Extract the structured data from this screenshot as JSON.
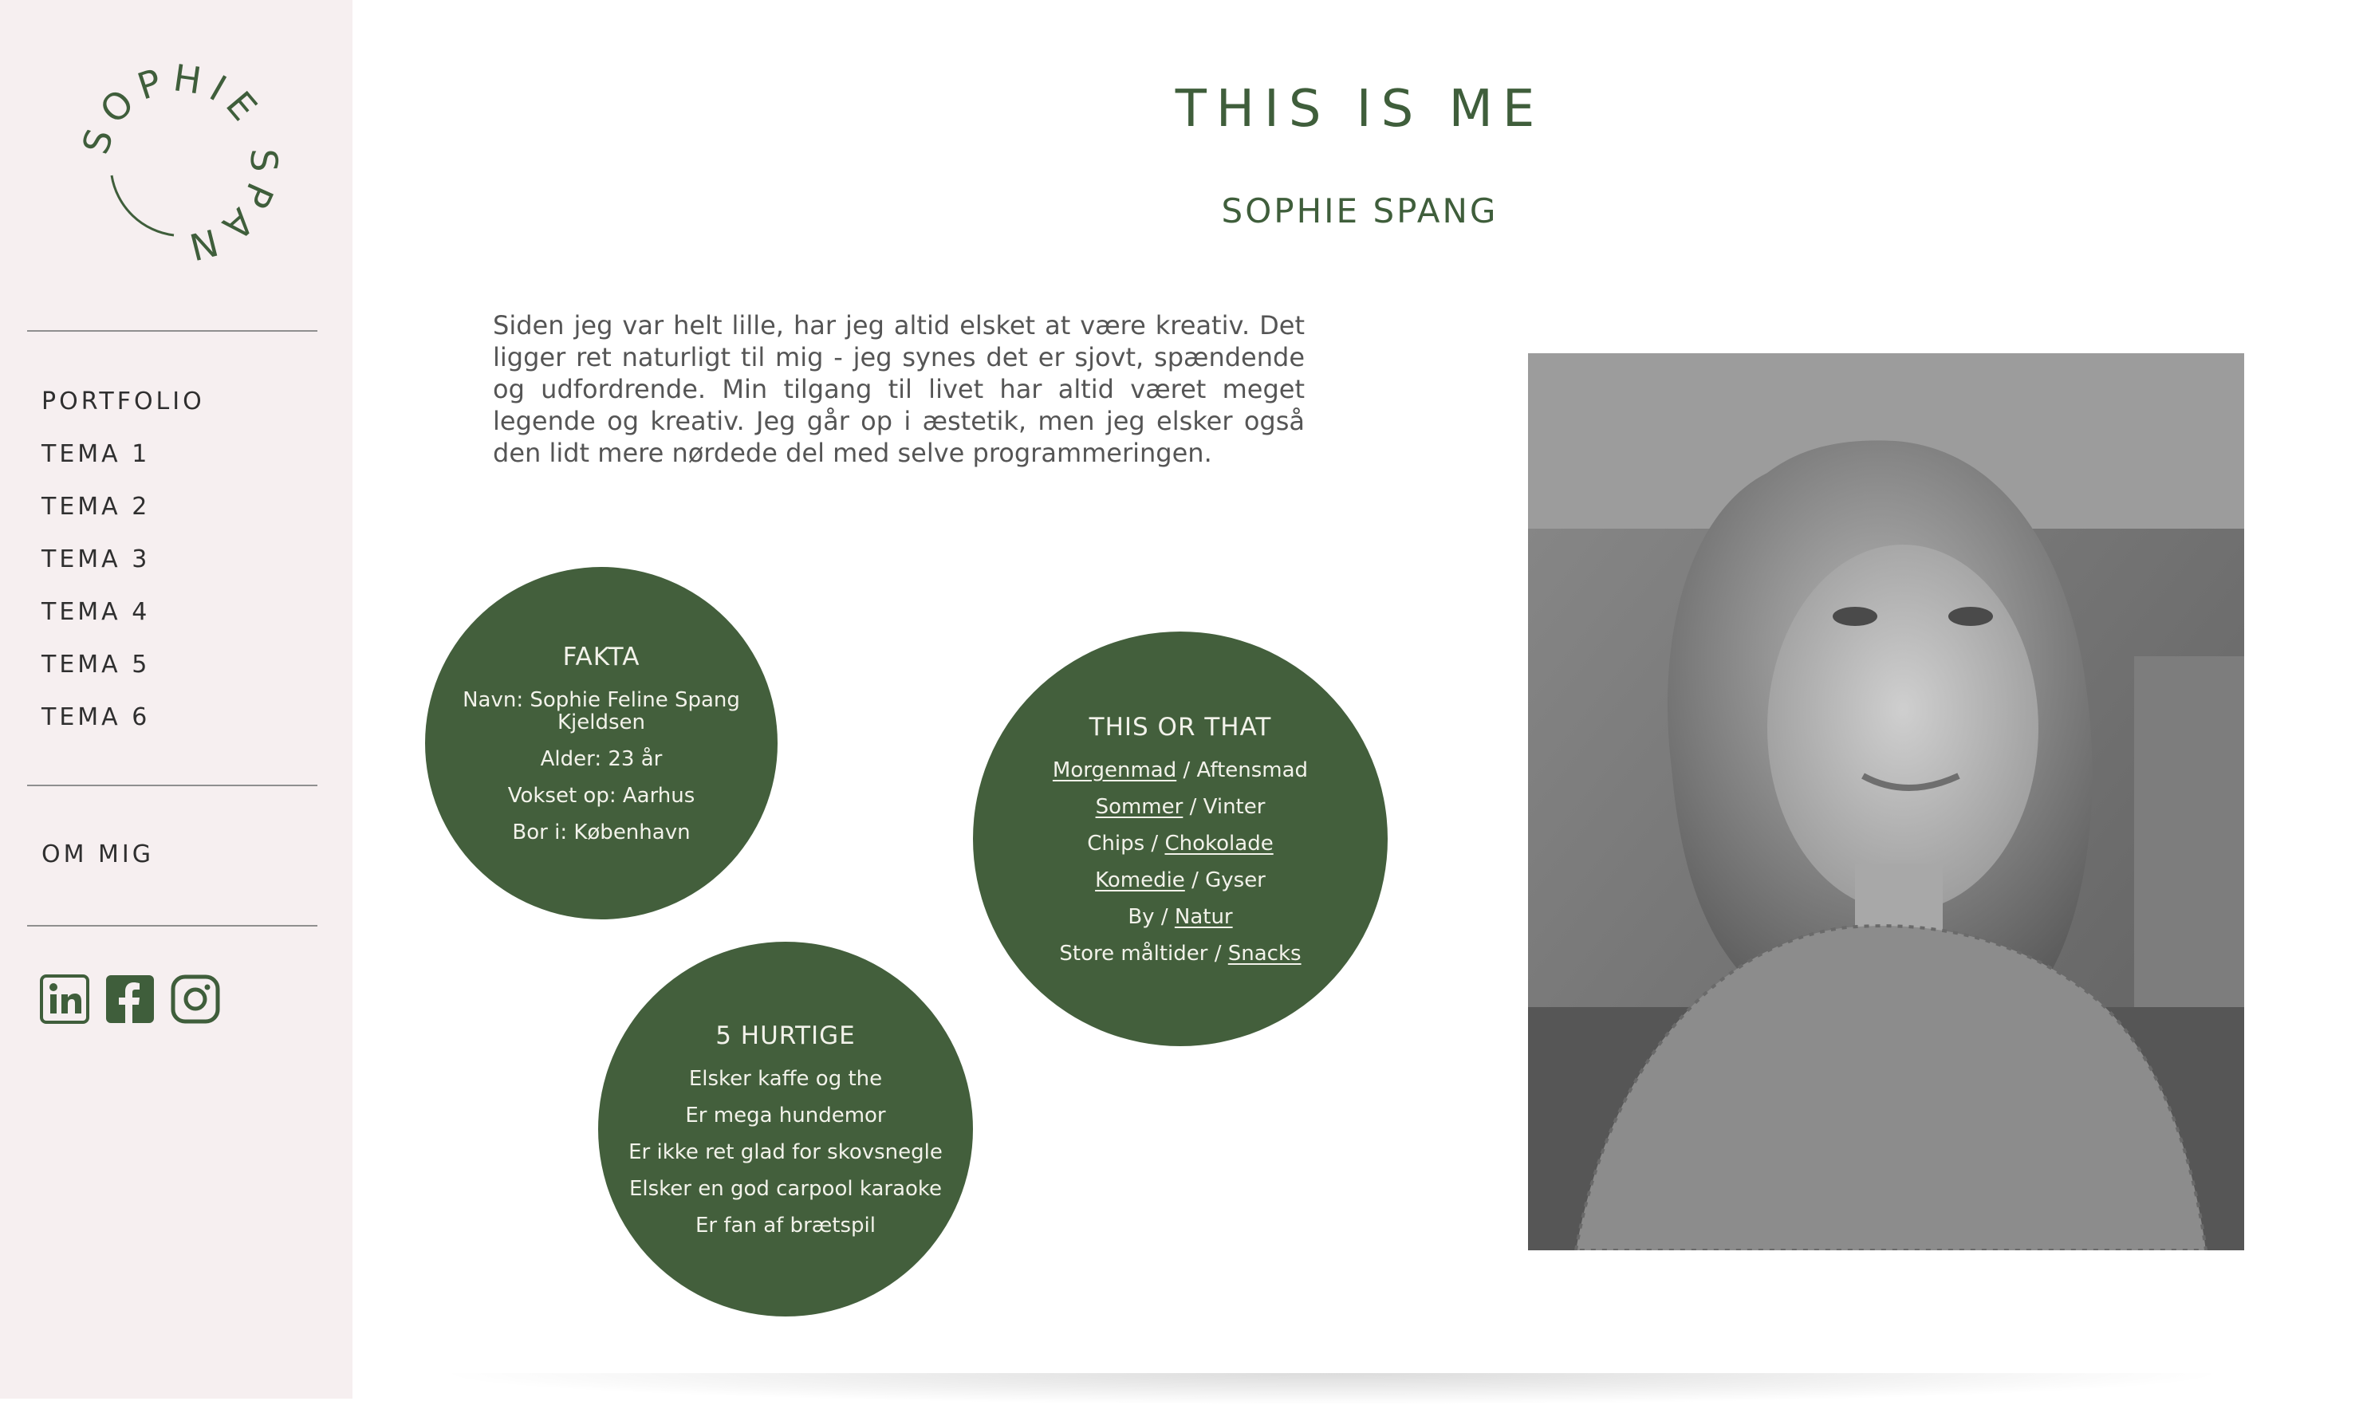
{
  "sidebar": {
    "logo_text": "SOPHIE SPANG",
    "nav": [
      {
        "label": "PORTFOLIO"
      },
      {
        "label": "TEMA 1"
      },
      {
        "label": "TEMA 2"
      },
      {
        "label": "TEMA 3"
      },
      {
        "label": "TEMA 4"
      },
      {
        "label": "TEMA 5"
      },
      {
        "label": "TEMA 6"
      }
    ],
    "om_mig": "OM MIG",
    "social": [
      {
        "icon": "linkedin-icon"
      },
      {
        "icon": "facebook-icon"
      },
      {
        "icon": "instagram-icon"
      }
    ]
  },
  "main": {
    "title": "THIS IS ME",
    "subtitle": "SOPHIE SPANG",
    "intro": "Siden jeg var helt lille, har jeg altid elsket at være kreativ. Det ligger ret naturligt til mig - jeg synes det er sjovt, spændende og udfordrende. Min tilgang til livet har altid været meget legende og kreativ. Jeg går op i æstetik, men jeg elsker også den lidt mere nørdede del med selve programmeringen."
  },
  "fakta": {
    "title": "FAKTA",
    "lines": [
      "Navn: Sophie Feline Spang Kjeldsen",
      "Alder: 23 år",
      "Vokset op: Aarhus",
      "Bor i: København"
    ]
  },
  "this_or_that": {
    "title": "THIS OR THAT",
    "pairs": [
      {
        "a": "Morgenmad",
        "b": "Aftensmad",
        "chosen": "a"
      },
      {
        "a": "Sommer",
        "b": "Vinter",
        "chosen": "a"
      },
      {
        "a": "Chips",
        "b": "Chokolade",
        "chosen": "b"
      },
      {
        "a": "Komedie",
        "b": "Gyser",
        "chosen": "a"
      },
      {
        "a": "By",
        "b": "Natur",
        "chosen": "b"
      },
      {
        "a": "Store måltider",
        "b": "Snacks",
        "chosen": "b"
      }
    ],
    "separator": " / "
  },
  "hurtige": {
    "title": "5 HURTIGE",
    "lines": [
      "Elsker kaffe og the",
      "Er mega hundemor",
      "Er ikke ret glad for skovsnegle",
      "Elsker en god carpool karaoke",
      "Er fan af brætspil"
    ]
  },
  "colors": {
    "accent": "#435f3c",
    "sidebar_bg": "#f6eff0",
    "circle_text": "#f2f2ea"
  }
}
